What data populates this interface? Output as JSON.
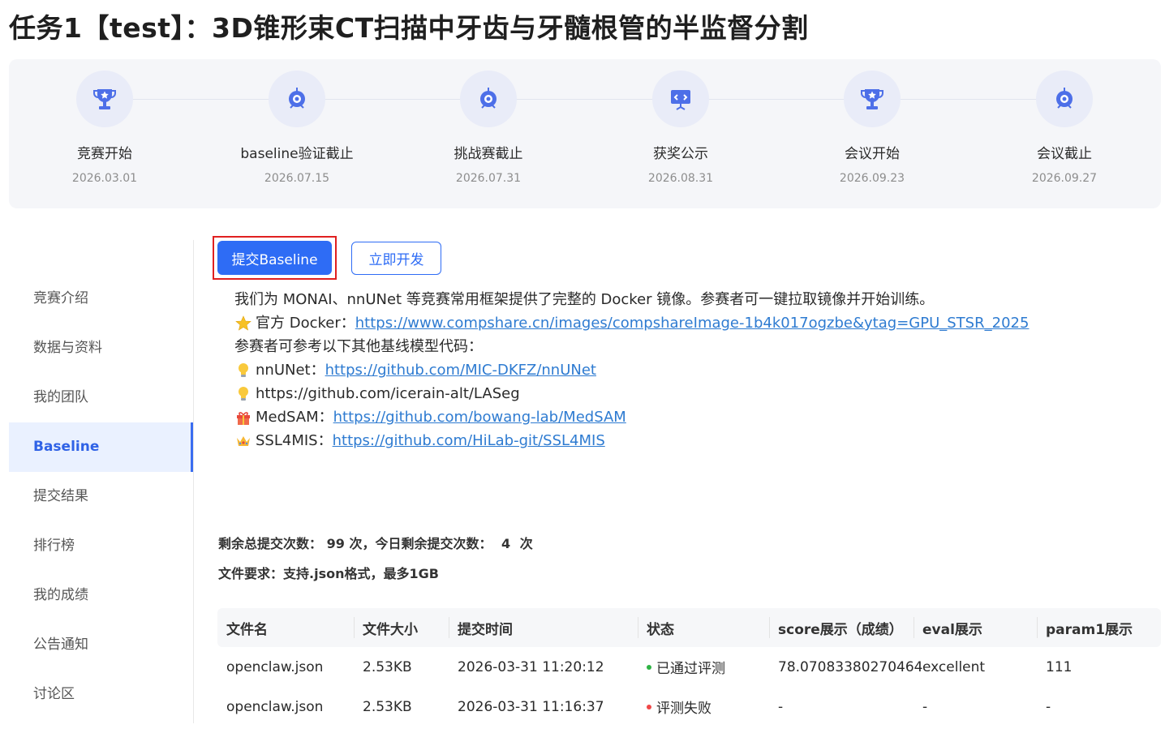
{
  "page": {
    "title": "任务1【test】：3D锥形束CT扫描中牙齿与牙髓根管的半监督分割"
  },
  "timeline": [
    {
      "label": "竞赛开始",
      "date": "2026.03.01",
      "icon": "trophy-icon"
    },
    {
      "label": "baseline验证截止",
      "date": "2026.07.15",
      "icon": "target-icon"
    },
    {
      "label": "挑战赛截止",
      "date": "2026.07.31",
      "icon": "target-icon"
    },
    {
      "label": "获奖公示",
      "date": "2026.08.31",
      "icon": "presentation-icon"
    },
    {
      "label": "会议开始",
      "date": "2026.09.23",
      "icon": "trophy-icon"
    },
    {
      "label": "会议截止",
      "date": "2026.09.27",
      "icon": "target-icon"
    }
  ],
  "sidebar": {
    "items": [
      {
        "label": "竞赛介绍"
      },
      {
        "label": "数据与资料"
      },
      {
        "label": "我的团队"
      },
      {
        "label": "Baseline",
        "active": true
      },
      {
        "label": "提交结果"
      },
      {
        "label": "排行榜"
      },
      {
        "label": "我的成绩"
      },
      {
        "label": "公告通知"
      },
      {
        "label": "讨论区"
      }
    ]
  },
  "actions": {
    "submit_label": "提交Baseline",
    "develop_label": "立即开发"
  },
  "description": {
    "intro": "我们为 MONAI、nnUNet 等竞赛常用框架提供了完整的 Docker 镜像。参赛者可一键拉取镜像并开始训练。",
    "docker_prefix": "官方 Docker：",
    "docker_link": "https://www.compshare.cn/images/compshareImage-1b4k017ogzbe&ytag=GPU_STSR_2025",
    "baselines_intro": "参赛者可参考以下其他基线模型代码：",
    "nnunet_prefix": "nnUNet：",
    "nnunet_link": "https://github.com/MIC-DKFZ/nnUNet",
    "laseg_text": "https://github.com/icerain-alt/LASeg",
    "medsam_prefix": "MedSAM：",
    "medsam_link": "https://github.com/bowang-lab/MedSAM",
    "ssl4mis_prefix": "SSL4MIS：",
    "ssl4mis_link": "https://github.com/HiLab-git/SSL4MIS"
  },
  "quota": {
    "total_label": "剩余总提交次数：",
    "total_value": "99",
    "unit": "次",
    "today_label": "，今日剩余提交次数：",
    "today_value": "4"
  },
  "file_req": "文件要求：支持.json格式，最多1GB",
  "table": {
    "headers": [
      "文件名",
      "文件大小",
      "提交时间",
      "状态",
      "score展示（成绩）",
      "eval展示",
      "param1展示"
    ],
    "rows": [
      {
        "filename": "openclaw.json",
        "size": "2.53KB",
        "time": "2026-03-31 11:20:12",
        "status": "已通过评测",
        "status_color": "#2fb344",
        "score": "78.07083380270464",
        "eval": "excellent",
        "param1": "111"
      },
      {
        "filename": "openclaw.json",
        "size": "2.53KB",
        "time": "2026-03-31 11:16:37",
        "status": "评测失败",
        "status_color": "#f04848",
        "score": "-",
        "eval": "-",
        "param1": "-"
      }
    ]
  },
  "colors": {
    "primary": "#2e6cf5",
    "link": "#2e7bd1",
    "highlight_border": "#e02020",
    "success": "#2fb344",
    "fail": "#f04848"
  }
}
